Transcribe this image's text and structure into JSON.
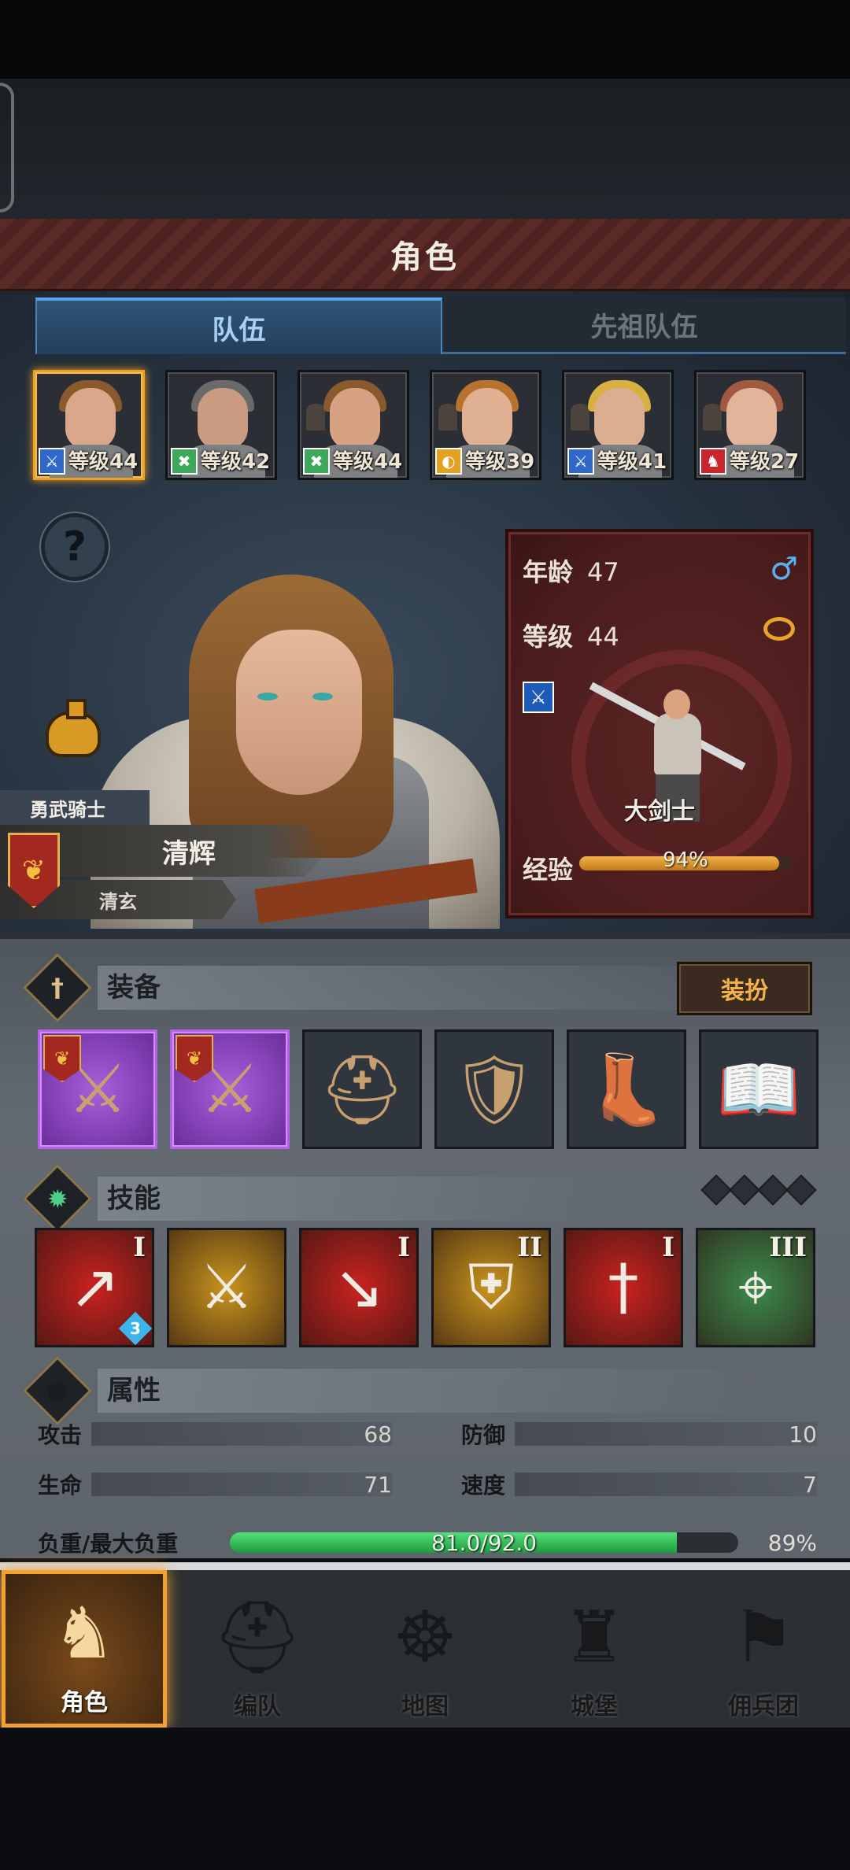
{
  "header": {
    "title": "角色"
  },
  "tabs": [
    {
      "label": "队伍",
      "active": true
    },
    {
      "label": "先祖队伍",
      "active": false
    }
  ],
  "roster": [
    {
      "level_text": "等级44",
      "role": "sword",
      "role_color": "#2f68c9",
      "hair": "#8a5a2e",
      "skin": "#d9a88a",
      "selected": true
    },
    {
      "level_text": "等级42",
      "role": "bow",
      "role_color": "#3da85a",
      "hair": "#6a6a6a",
      "skin": "#c99c82",
      "selected": false
    },
    {
      "level_text": "等级44",
      "role": "bow",
      "role_color": "#3da85a",
      "hair": "#8a5a2e",
      "skin": "#d7a283",
      "selected": false
    },
    {
      "level_text": "等级39",
      "role": "shield",
      "role_color": "#e5a020",
      "hair": "#b8722e",
      "skin": "#e0b092",
      "selected": false
    },
    {
      "level_text": "等级41",
      "role": "sword",
      "role_color": "#2f68c9",
      "hair": "#d8b040",
      "skin": "#dcae90",
      "selected": false
    },
    {
      "level_text": "等级27",
      "role": "horse",
      "role_color": "#c8262a",
      "hair": "#a05a40",
      "skin": "#e2b49a",
      "selected": false
    }
  ],
  "hero": {
    "class_tag": "勇武骑士",
    "name": "清辉",
    "sub_name": "清玄"
  },
  "info": {
    "age_label": "年龄",
    "age": "47",
    "level_label": "等级",
    "level": "44",
    "class_name": "大剑士",
    "exp_label": "经验",
    "exp_text": "94%",
    "exp_fraction": 0.94
  },
  "equipment": {
    "title": "装备",
    "dress_button": "装扮",
    "slots": [
      {
        "icon": "crossed-swords-icon",
        "epic": true
      },
      {
        "icon": "crossed-swords-icon",
        "epic": true
      },
      {
        "icon": "helmet-icon",
        "epic": false
      },
      {
        "icon": "armor-icon",
        "epic": false
      },
      {
        "icon": "boots-icon",
        "epic": false
      },
      {
        "icon": "book-icon",
        "epic": false
      }
    ]
  },
  "skills": {
    "title": "技能",
    "items": [
      {
        "icon": "sword-strike-icon",
        "rank": "I",
        "bg": "#c8231f",
        "badge": "3"
      },
      {
        "icon": "sword-aura-icon",
        "rank": "",
        "bg": "#c9951d",
        "badge": ""
      },
      {
        "icon": "shatter-strike-icon",
        "rank": "I",
        "bg": "#c8231f",
        "badge": ""
      },
      {
        "icon": "shield-icon",
        "rank": "II",
        "bg": "#c9951d",
        "badge": ""
      },
      {
        "icon": "sword-icon",
        "rank": "I",
        "bg": "#c8231f",
        "badge": ""
      },
      {
        "icon": "target-icon",
        "rank": "III",
        "bg": "#3d8a4c",
        "badge": ""
      }
    ]
  },
  "attributes": {
    "title": "属性",
    "attack_label": "攻击",
    "attack": "68",
    "defense_label": "防御",
    "defense": "10",
    "hp_label": "生命",
    "hp": "71",
    "speed_label": "速度",
    "speed": "7",
    "load_label": "负重/最大负重",
    "load_text": "81.0/92.0",
    "load_fraction": 0.88,
    "load_pct": "89%"
  },
  "nav": [
    {
      "label": "角色",
      "icon": "knight-icon",
      "active": true
    },
    {
      "label": "编队",
      "icon": "helmet-icon",
      "active": false
    },
    {
      "label": "地图",
      "icon": "compass-icon",
      "active": false
    },
    {
      "label": "城堡",
      "icon": "castle-icon",
      "active": false
    },
    {
      "label": "佣兵团",
      "icon": "banner-icon",
      "active": false
    }
  ]
}
